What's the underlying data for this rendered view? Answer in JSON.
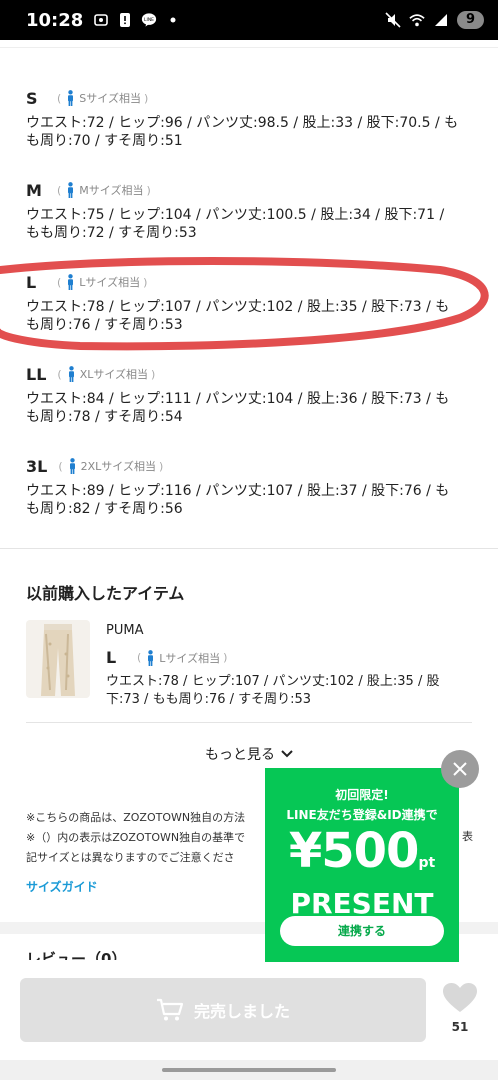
{
  "status_bar": {
    "time": "10:28",
    "battery": "9"
  },
  "sizes": [
    {
      "code": "S",
      "hint": "Sサイズ相当",
      "lines": [
        "ウエスト:72 / ヒップ:96 / パンツ丈:98.5 / 股上:33 / 股下:70.5 / も",
        "も周り:70 / すそ周り:51"
      ]
    },
    {
      "code": "M",
      "hint": "Mサイズ相当",
      "lines": [
        "ウエスト:75 / ヒップ:104 / パンツ丈:100.5 / 股上:34 / 股下:71 /",
        "もも周り:72 / すそ周り:53"
      ]
    },
    {
      "code": "L",
      "hint": "Lサイズ相当",
      "lines": [
        "ウエスト:78 / ヒップ:107 / パンツ丈:102 / 股上:35 / 股下:73 / も",
        "も周り:76 / すそ周り:53"
      ]
    },
    {
      "code": "LL",
      "hint": "XLサイズ相当",
      "lines": [
        "ウエスト:84 / ヒップ:111 / パンツ丈:104 / 股上:36 / 股下:73 / も",
        "も周り:78 / すそ周り:54"
      ]
    },
    {
      "code": "3L",
      "hint": "2XLサイズ相当",
      "lines": [
        "ウエスト:89 / ヒップ:116 / パンツ丈:107 / 股上:37 / 股下:76 / も",
        "も周り:82 / すそ周り:56"
      ]
    }
  ],
  "previous": {
    "title": "以前購入したアイテム",
    "brand": "PUMA",
    "size_code": "L",
    "size_hint": "Lサイズ相当",
    "lines": [
      "ウエスト:78 / ヒップ:107 / パンツ丈:102 / 股上:35 / 股",
      "下:73 / もも周り:76 / すそ周り:53"
    ],
    "more": "もっと見る"
  },
  "notes": {
    "line1": "※こちらの商品は、ZOZOTOWN独自の方法",
    "line2": "※（）内の表示はZOZOTOWN独自の基準で",
    "line2_tail": "表",
    "line3": "記サイズとは異なりますのでご注意くださ"
  },
  "size_guide": "サイズガイド",
  "review_peek": "レビュー（0）",
  "bottom": {
    "soldout": "完売しました",
    "fav_count": "51"
  },
  "promo": {
    "line1": "初回限定!",
    "line2": "LINE友だち登録&ID連携で",
    "amount": "¥500",
    "unit": "pt",
    "present": "PRESENT",
    "button": "連携する"
  },
  "colors": {
    "line_green": "#06c755",
    "accent_blue": "#1a9ad6",
    "person_icon": "#1f7fd0",
    "annotation_red": "#e04040"
  }
}
